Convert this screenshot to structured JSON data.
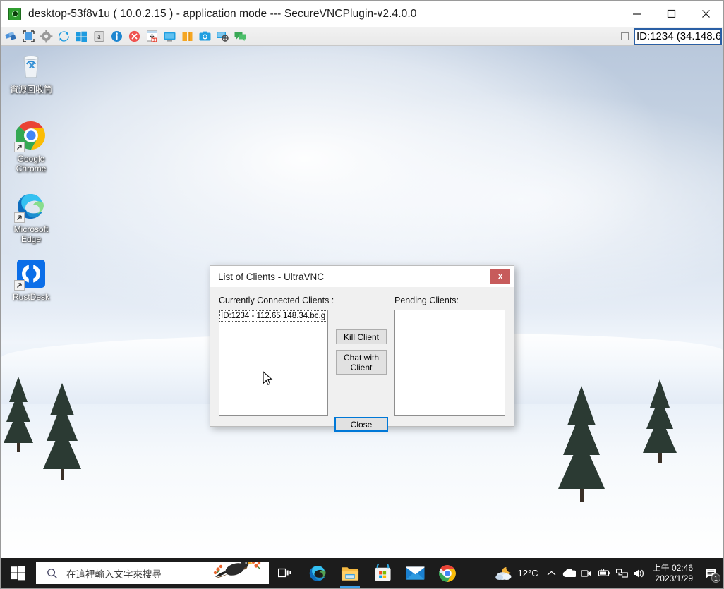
{
  "window": {
    "title": "desktop-53f8v1u ( 10.0.2.15 ) - application mode --- SecureVNCPlugin-v2.4.0.0",
    "icon": "vnc-eye-icon",
    "minimize_label": "Minimize",
    "maximize_label": "Maximize",
    "close_label": "Close"
  },
  "toolbar": {
    "buttons": [
      {
        "name": "connection-options-icon",
        "tip": "Connection options"
      },
      {
        "name": "fullscreen-icon",
        "tip": "Full screen"
      },
      {
        "name": "gear-icon",
        "tip": "Options"
      },
      {
        "name": "refresh-icon",
        "tip": "Refresh screen"
      },
      {
        "name": "windows-key-icon",
        "tip": "Send Windows key"
      },
      {
        "name": "ctrl-alt-del-icon",
        "tip": "Send Ctrl-Alt-Del"
      },
      {
        "name": "info-icon",
        "tip": "Connection info"
      },
      {
        "name": "disconnect-icon",
        "tip": "Disconnect"
      },
      {
        "name": "file-transfer-icon",
        "tip": "File transfer"
      },
      {
        "name": "monitor-icon",
        "tip": "Select monitor"
      },
      {
        "name": "scaling-icon",
        "tip": "Scaling"
      },
      {
        "name": "screenshot-icon",
        "tip": "Capture screen"
      },
      {
        "name": "zoom-target-icon",
        "tip": "Zoom to pointer"
      },
      {
        "name": "chat-icon",
        "tip": "Chat"
      }
    ],
    "checkbox_checked": false,
    "id_field_value": "ID:1234 (34.148.6"
  },
  "desktop": {
    "icons": [
      {
        "name": "recycle-bin",
        "label": "資源回收筒",
        "icon": "recycle-bin-icon",
        "shortcut": false
      },
      {
        "name": "google-chrome",
        "label": "Google\nChrome",
        "label_line1": "Google",
        "label_line2": "Chrome",
        "icon": "chrome-icon",
        "shortcut": true
      },
      {
        "name": "microsoft-edge",
        "label_line1": "Microsoft",
        "label_line2": "Edge",
        "icon": "edge-icon",
        "shortcut": true
      },
      {
        "name": "rustdesk",
        "label_line1": "RustDesk",
        "label_line2": "",
        "icon": "rustdesk-icon",
        "shortcut": true
      }
    ]
  },
  "dialog": {
    "title": "List of Clients - UltraVNC",
    "close_label": "x",
    "connected_label": "Currently Connected Clients :",
    "pending_label": "Pending Clients:",
    "connected_clients": [
      "ID:1234 - 112.65.148.34.bc.g"
    ],
    "pending_clients": [],
    "kill_client_label": "Kill Client",
    "chat_with_client_label": "Chat with Client",
    "close_button_label": "Close"
  },
  "taskbar": {
    "start_label": "Start",
    "search_placeholder": "在這裡輸入文字來搜尋",
    "search_icon": "search-icon",
    "apps": [
      {
        "name": "task-view",
        "icon": "task-view-icon",
        "active": false
      },
      {
        "name": "microsoft-edge",
        "icon": "edge-icon",
        "active": false
      },
      {
        "name": "file-explorer",
        "icon": "folder-icon",
        "active": true
      },
      {
        "name": "microsoft-store",
        "icon": "store-icon",
        "active": false
      },
      {
        "name": "mail",
        "icon": "mail-icon",
        "active": false
      },
      {
        "name": "google-chrome",
        "icon": "chrome-icon",
        "active": false
      }
    ],
    "weather_temp": "12°C",
    "weather_icon": "partly-cloudy-night-icon",
    "tray_icons": [
      "chevron-up-icon",
      "onedrive-cloud-icon",
      "camera-icon",
      "battery-icon",
      "network-icon",
      "volume-icon"
    ],
    "clock_time": "上午 02:46",
    "clock_date": "2023/1/29",
    "notification_count": "1",
    "notification_icon": "notification-icon"
  },
  "colors": {
    "accent": "#0078d7",
    "dialog_close_red": "#c75b5b",
    "taskbar_bg": "#1c1c1c",
    "toolbar_bg": "#eeeeee",
    "id_field_border": "#2a5fa5"
  }
}
